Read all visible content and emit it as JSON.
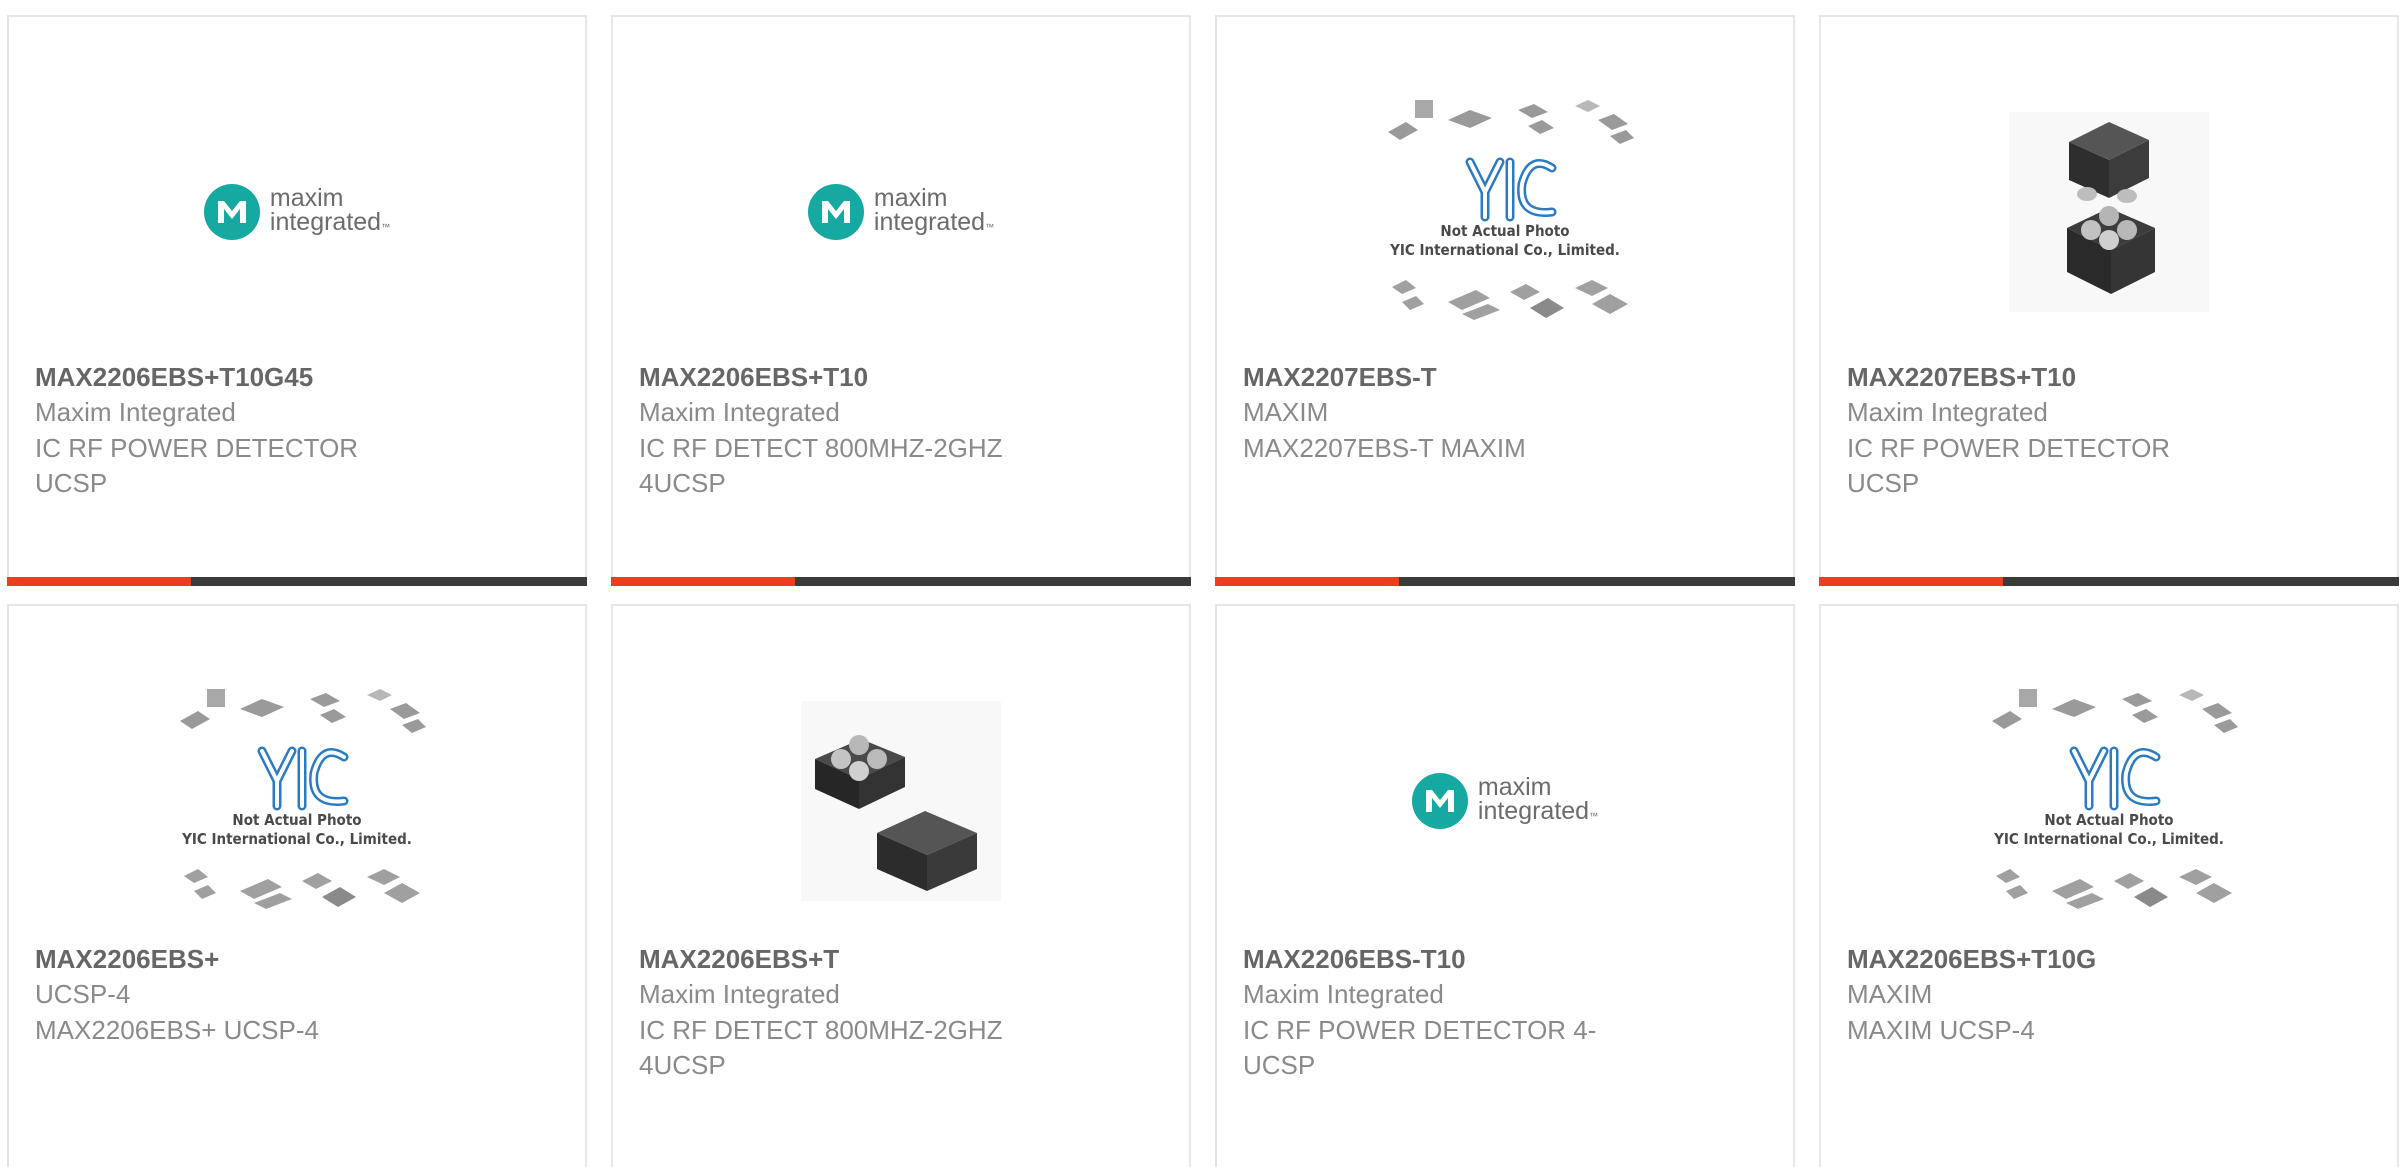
{
  "icons": {
    "maxim": "maxim-integrated-logo",
    "yic": "yic-not-actual-photo",
    "chip_a": "ucsp-chip-photo",
    "chip_b": "ucsp-chip-photo-alt"
  },
  "colors": {
    "accent": "#e8401c",
    "bar": "#3a3a3a",
    "maxim_teal": "#15a9a2",
    "yic_blue": "#2a7bc4"
  },
  "logo": {
    "maxim_line1": "maxim",
    "maxim_line2": "integrated",
    "maxim_tm": "TM",
    "yic_letters": "YIC",
    "yic_caption1": "Not Actual Photo",
    "yic_caption2": "YIC International Co., Limited."
  },
  "products": [
    {
      "part": "MAX2206EBS+T10G45",
      "lines": [
        "Maxim Integrated",
        "IC RF POWER DETECTOR",
        "UCSP"
      ]
    },
    {
      "part": "MAX2206EBS+T10",
      "lines": [
        "Maxim Integrated",
        "IC RF DETECT 800MHZ-2GHZ",
        "4UCSP"
      ]
    },
    {
      "part": "MAX2207EBS-T",
      "lines": [
        "MAXIM",
        "MAX2207EBS-T MAXIM",
        ""
      ]
    },
    {
      "part": "MAX2207EBS+T10",
      "lines": [
        "Maxim Integrated",
        "IC RF POWER DETECTOR",
        "UCSP"
      ]
    },
    {
      "part": "MAX2206EBS+",
      "lines": [
        "UCSP-4",
        "MAX2206EBS+ UCSP-4",
        ""
      ]
    },
    {
      "part": "MAX2206EBS+T",
      "lines": [
        "Maxim Integrated",
        "IC RF DETECT 800MHZ-2GHZ",
        "4UCSP"
      ]
    },
    {
      "part": "MAX2206EBS-T10",
      "lines": [
        "Maxim Integrated",
        "IC RF POWER DETECTOR 4-",
        "UCSP"
      ]
    },
    {
      "part": "MAX2206EBS+T10G",
      "lines": [
        "MAXIM",
        "MAXIM UCSP-4",
        ""
      ]
    }
  ]
}
